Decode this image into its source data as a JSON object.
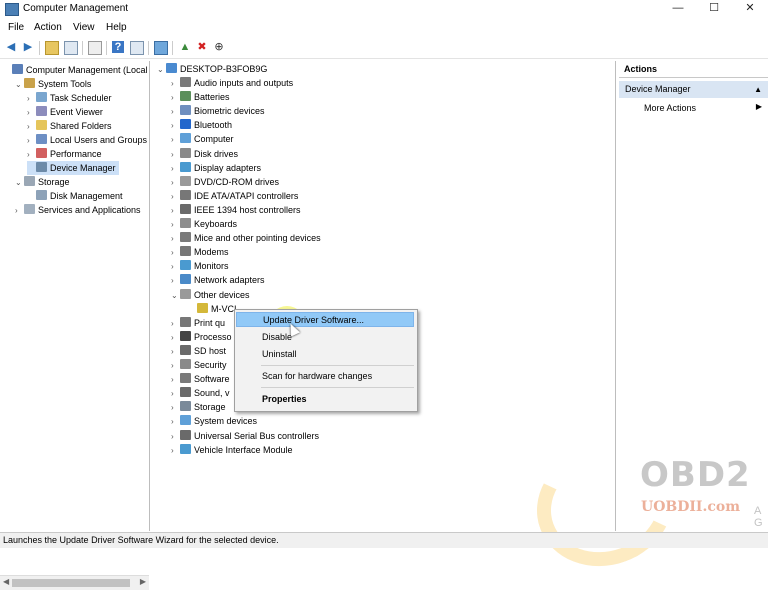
{
  "window": {
    "title": "Computer Management",
    "controls": [
      "—",
      "☐",
      "✕"
    ]
  },
  "menu": [
    "File",
    "Action",
    "View",
    "Help"
  ],
  "toolbar_icons": [
    "back-icon",
    "forward-icon",
    "up-folder-icon",
    "show-tree-icon",
    "properties-icon",
    "help-icon",
    "console-tree-icon",
    "monitor-icon",
    "update-driver-icon",
    "uninstall-icon",
    "disable-icon"
  ],
  "left_tree": [
    {
      "label": "Computer Management (Local",
      "level": 0,
      "exp": "",
      "icon": "#5a7fb8"
    },
    {
      "label": "System Tools",
      "level": 1,
      "exp": "⌄",
      "icon": "#c9a24a"
    },
    {
      "label": "Task Scheduler",
      "level": 2,
      "exp": "›",
      "icon": "#7aa6cf"
    },
    {
      "label": "Event Viewer",
      "level": 2,
      "exp": "›",
      "icon": "#8c8cbc"
    },
    {
      "label": "Shared Folders",
      "level": 2,
      "exp": "›",
      "icon": "#e5c55b"
    },
    {
      "label": "Local Users and Groups",
      "level": 2,
      "exp": "›",
      "icon": "#6d8fc4"
    },
    {
      "label": "Performance",
      "level": 2,
      "exp": "›",
      "icon": "#d26060"
    },
    {
      "label": "Device Manager",
      "level": 2,
      "exp": "",
      "icon": "#6c8aa8",
      "selected": true
    },
    {
      "label": "Storage",
      "level": 1,
      "exp": "⌄",
      "icon": "#9aa7b5"
    },
    {
      "label": "Disk Management",
      "level": 2,
      "exp": "",
      "icon": "#8da2b8"
    },
    {
      "label": "Services and Applications",
      "level": 1,
      "exp": "›",
      "icon": "#a2b0bf"
    }
  ],
  "device_tree": {
    "root": "DESKTOP-B3FOB9G",
    "items": [
      {
        "label": "Audio inputs and outputs",
        "exp": "›",
        "icon": "#7a7a7a"
      },
      {
        "label": "Batteries",
        "exp": "›",
        "icon": "#5b8f5b"
      },
      {
        "label": "Biometric devices",
        "exp": "›",
        "icon": "#6f8fbf"
      },
      {
        "label": "Bluetooth",
        "exp": "›",
        "icon": "#2266cc"
      },
      {
        "label": "Computer",
        "exp": "›",
        "icon": "#5fa0d8"
      },
      {
        "label": "Disk drives",
        "exp": "›",
        "icon": "#8a8a8a"
      },
      {
        "label": "Display adapters",
        "exp": "›",
        "icon": "#4a9ad0"
      },
      {
        "label": "DVD/CD-ROM drives",
        "exp": "›",
        "icon": "#9a9a9a"
      },
      {
        "label": "IDE ATA/ATAPI controllers",
        "exp": "›",
        "icon": "#777777"
      },
      {
        "label": "IEEE 1394 host controllers",
        "exp": "›",
        "icon": "#6a6a6a"
      },
      {
        "label": "Keyboards",
        "exp": "›",
        "icon": "#8d8d8d"
      },
      {
        "label": "Mice and other pointing devices",
        "exp": "›",
        "icon": "#7a7a7a"
      },
      {
        "label": "Modems",
        "exp": "›",
        "icon": "#777777"
      },
      {
        "label": "Monitors",
        "exp": "›",
        "icon": "#4a9ad0"
      },
      {
        "label": "Network adapters",
        "exp": "›",
        "icon": "#4a8ac8"
      },
      {
        "label": "Other devices",
        "exp": "⌄",
        "icon": "#9a9a9a"
      },
      {
        "label": "M-VCI",
        "exp": "",
        "icon": "#d4b83a",
        "child": true
      },
      {
        "label": "Print qu",
        "exp": "›",
        "icon": "#777777"
      },
      {
        "label": "Processo",
        "exp": "›",
        "icon": "#444444"
      },
      {
        "label": "SD host",
        "exp": "›",
        "icon": "#6a6a6a"
      },
      {
        "label": "Security",
        "exp": "›",
        "icon": "#8a8a8a"
      },
      {
        "label": "Software",
        "exp": "›",
        "icon": "#7a7a7a"
      },
      {
        "label": "Sound, v",
        "exp": "›",
        "icon": "#6a6a6a"
      },
      {
        "label": "Storage",
        "exp": "›",
        "icon": "#7a8a9a"
      },
      {
        "label": "System devices",
        "exp": "›",
        "icon": "#5fa0d8"
      },
      {
        "label": "Universal Serial Bus controllers",
        "exp": "›",
        "icon": "#6a6a6a"
      },
      {
        "label": "Vehicle Interface Module",
        "exp": "›",
        "icon": "#4a9ad0"
      }
    ]
  },
  "context_menu": [
    {
      "label": "Update Driver Software...",
      "highlighted": true
    },
    {
      "label": "Disable"
    },
    {
      "label": "Uninstall"
    },
    {
      "label": "Scan for hardware changes"
    },
    {
      "label": "Properties",
      "bold": true
    }
  ],
  "actions": {
    "header": "Actions",
    "section": "Device Manager",
    "more": "More Actions"
  },
  "status": "Launches the Update Driver Software Wizard for the selected device.",
  "watermark": {
    "brand": "OBD2",
    "site": "UOBDII.com",
    "corner": "A\nG"
  }
}
